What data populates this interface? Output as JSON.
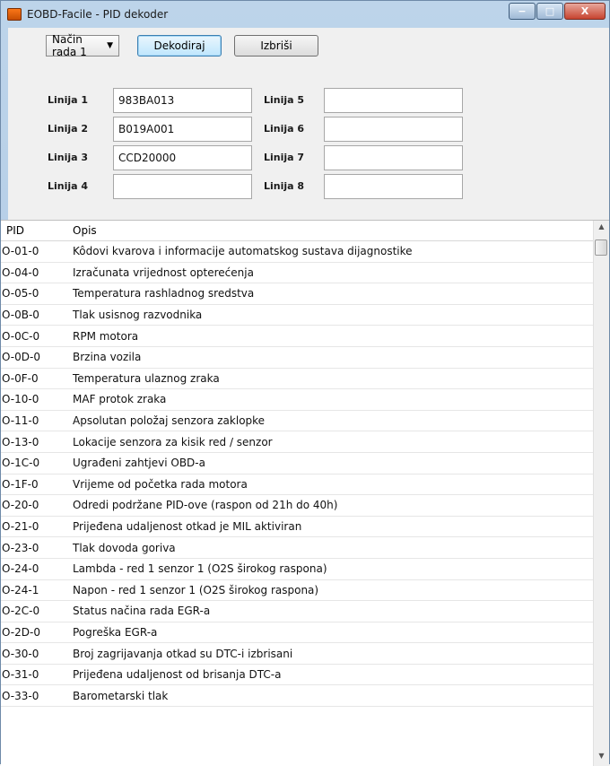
{
  "window": {
    "title": "EOBD-Facile - PID dekoder"
  },
  "caption": {
    "minimize": "−",
    "maximize": "□",
    "close": "X"
  },
  "toolbar": {
    "mode_value": "Način rada 1",
    "decode_label": "Dekodiraj",
    "clear_label": "Izbriši"
  },
  "lines": [
    {
      "label": "Linija 1",
      "value": "983BA013"
    },
    {
      "label": "Linija 2",
      "value": "B019A001"
    },
    {
      "label": "Linija 3",
      "value": "CCD20000"
    },
    {
      "label": "Linija 4",
      "value": ""
    },
    {
      "label": "Linija 5",
      "value": ""
    },
    {
      "label": "Linija 6",
      "value": ""
    },
    {
      "label": "Linija 7",
      "value": ""
    },
    {
      "label": "Linija 8",
      "value": ""
    }
  ],
  "table": {
    "columns": [
      "PID",
      "Opis"
    ],
    "rows": [
      {
        "pid": "O-01-0",
        "opis": "Kôdovi kvarova i informacije automatskog sustava dijagnostike"
      },
      {
        "pid": "O-04-0",
        "opis": "Izračunata vrijednost opterećenja"
      },
      {
        "pid": "O-05-0",
        "opis": "Temperatura rashladnog sredstva"
      },
      {
        "pid": "O-0B-0",
        "opis": "Tlak usisnog razvodnika"
      },
      {
        "pid": "O-0C-0",
        "opis": "RPM motora"
      },
      {
        "pid": "O-0D-0",
        "opis": "Brzina vozila"
      },
      {
        "pid": "O-0F-0",
        "opis": "Temperatura ulaznog zraka"
      },
      {
        "pid": "O-10-0",
        "opis": "MAF protok zraka"
      },
      {
        "pid": "O-11-0",
        "opis": "Apsolutan položaj senzora zaklopke"
      },
      {
        "pid": "O-13-0",
        "opis": "Lokacije senzora za kisik  red / senzor"
      },
      {
        "pid": "O-1C-0",
        "opis": "Ugrađeni zahtjevi OBD-a"
      },
      {
        "pid": "O-1F-0",
        "opis": "Vrijeme od početka rada motora"
      },
      {
        "pid": "O-20-0",
        "opis": "Odredi podržane PID-ove (raspon od 21h do 40h)"
      },
      {
        "pid": "O-21-0",
        "opis": "Prijeđena udaljenost otkad je MIL aktiviran"
      },
      {
        "pid": "O-23-0",
        "opis": "Tlak dovoda goriva"
      },
      {
        "pid": "O-24-0",
        "opis": "Lambda - red 1 senzor 1 (O2S širokog raspona)"
      },
      {
        "pid": "O-24-1",
        "opis": "Napon - red 1 senzor 1 (O2S širokog raspona)"
      },
      {
        "pid": "O-2C-0",
        "opis": "Status načina rada EGR-a"
      },
      {
        "pid": "O-2D-0",
        "opis": "Pogreška EGR-a"
      },
      {
        "pid": "O-30-0",
        "opis": "Broj zagrijavanja otkad su DTC-i izbrisani"
      },
      {
        "pid": "O-31-0",
        "opis": "Prijeđena udaljenost od brisanja DTC-a"
      },
      {
        "pid": "O-33-0",
        "opis": "Barometarski tlak"
      }
    ]
  },
  "scrollbar": {
    "up": "▲",
    "down": "▼"
  },
  "icons": {
    "app": "eobd-app-icon",
    "dropdown": "chevron-down-icon"
  },
  "colors": {
    "decode_accent": "#3c7fb1",
    "close_button": "#c7432f"
  }
}
